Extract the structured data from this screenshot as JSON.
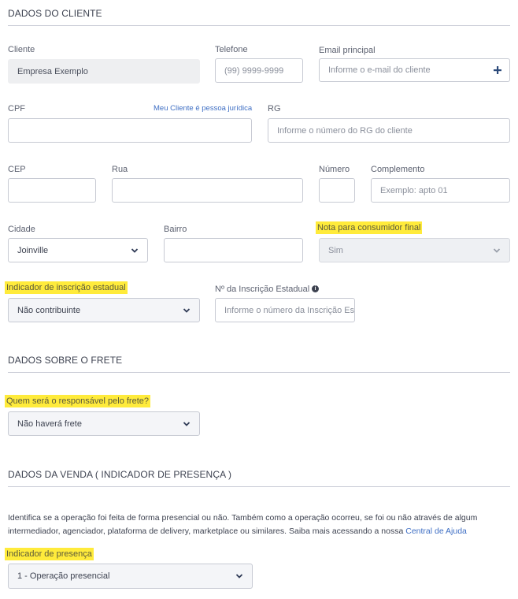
{
  "sections": {
    "cliente": "DADOS DO CLIENTE",
    "frete": "DADOS SOBRE O FRETE",
    "venda": "DADOS DA VENDA ( INDICADOR DE PRESENÇA )"
  },
  "cliente": {
    "label": "Cliente",
    "value": "Empresa Exemplo"
  },
  "telefone": {
    "label": "Telefone",
    "placeholder": "(99) 9999-9999"
  },
  "email": {
    "label": "Email principal",
    "placeholder": "Informe o e-mail do cliente",
    "add_icon": "plus-icon"
  },
  "cpf": {
    "label": "CPF",
    "link": "Meu Cliente é pessoa jurídica"
  },
  "rg": {
    "label": "RG",
    "placeholder": "Informe o número do RG do cliente"
  },
  "cep": {
    "label": "CEP"
  },
  "rua": {
    "label": "Rua"
  },
  "numero": {
    "label": "Número"
  },
  "complemento": {
    "label": "Complemento",
    "placeholder": "Exemplo: apto 01"
  },
  "cidade": {
    "label": "Cidade",
    "value": "Joinville"
  },
  "bairro": {
    "label": "Bairro"
  },
  "nota_consumidor": {
    "label": "Nota para consumidor final",
    "value": "Sim"
  },
  "indicador_ie": {
    "label": "Indicador de inscrição estadual",
    "value": "Não contribuinte"
  },
  "inscricao_estadual": {
    "label": "Nº da Inscrição Estadual",
    "placeholder": "Informe o número da Inscrição Es",
    "info_icon": "i"
  },
  "frete": {
    "label": "Quem será o responsável pelo frete?",
    "value": "Não haverá frete"
  },
  "venda": {
    "description": "Identifica se a operação foi feita de forma presencial ou não. Também como a operação ocorreu, se foi ou não através de algum intermediador, agenciador, plataforma de delivery, marketplace ou similares. Saiba mais acessando a nossa ",
    "help_link": "Central de Ajuda",
    "presenca_label": "Indicador de presença",
    "presenca_value": "1 - Operação presencial"
  },
  "colors": {
    "highlight": "#ffeb3b",
    "link": "#3f6fc4",
    "border": "#c7cad3"
  }
}
